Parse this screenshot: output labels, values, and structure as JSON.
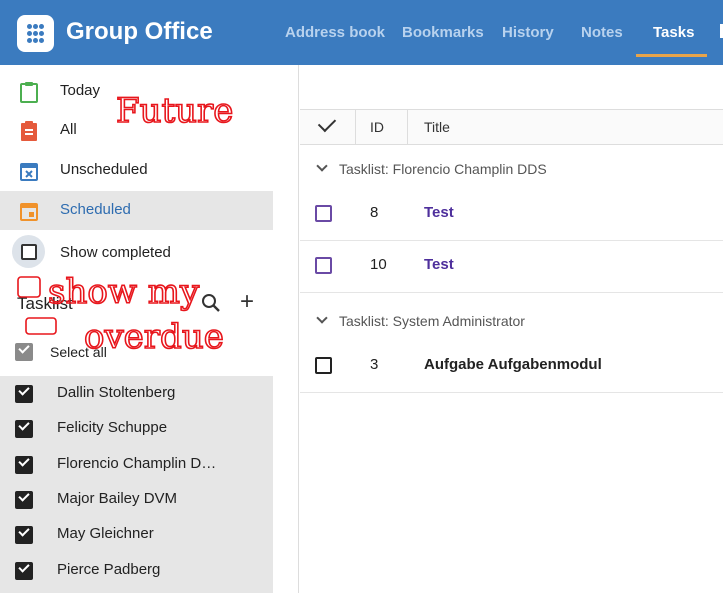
{
  "app": {
    "name": "Group Office"
  },
  "nav": {
    "items": [
      {
        "label": "Address book"
      },
      {
        "label": "Bookmarks"
      },
      {
        "label": "History"
      },
      {
        "label": "Notes"
      },
      {
        "label": "Tasks",
        "active": true
      }
    ]
  },
  "sidebar": {
    "filters": [
      {
        "label": "Today",
        "icon": "clipboard-icon",
        "color": "#4caf50"
      },
      {
        "label": "All",
        "icon": "list-clipboard-icon",
        "color": "#e55a3c"
      },
      {
        "label": "Unscheduled",
        "icon": "calendar-x-icon",
        "color": "#3b7bbf"
      },
      {
        "label": "Scheduled",
        "icon": "calendar-icon",
        "color": "#f0922b",
        "active": true
      }
    ],
    "show_completed": {
      "label": "Show completed",
      "checked": false
    },
    "tasklist_header": "Tasklist",
    "select_all": {
      "label": "Select all",
      "checked": true
    },
    "tasklists": [
      {
        "label": "Dallin Stoltenberg",
        "checked": true
      },
      {
        "label": "Felicity Schuppe",
        "checked": true
      },
      {
        "label": "Florencio Champlin D…",
        "checked": true
      },
      {
        "label": "Major Bailey DVM",
        "checked": true
      },
      {
        "label": "May Gleichner",
        "checked": true
      },
      {
        "label": "Pierce Padberg",
        "checked": true
      }
    ]
  },
  "table": {
    "columns": [
      "ID",
      "Title"
    ],
    "groups": [
      {
        "label": "Tasklist: Florencio Champlin DDS",
        "rows": [
          {
            "id": "8",
            "title": "Test"
          },
          {
            "id": "10",
            "title": "Test"
          }
        ]
      },
      {
        "label": "Tasklist: System Administrator",
        "rows": [
          {
            "id": "3",
            "title": "Aufgabe Aufgabenmodul"
          }
        ]
      }
    ]
  },
  "annotations": {
    "future": "Future",
    "show_my": "show my",
    "overdue": "overdue"
  },
  "colors": {
    "header": "#3b7bbf",
    "accent": "#e8a44a",
    "task_title": "#4e2f9c",
    "annotation_ink": "#e8161c"
  }
}
